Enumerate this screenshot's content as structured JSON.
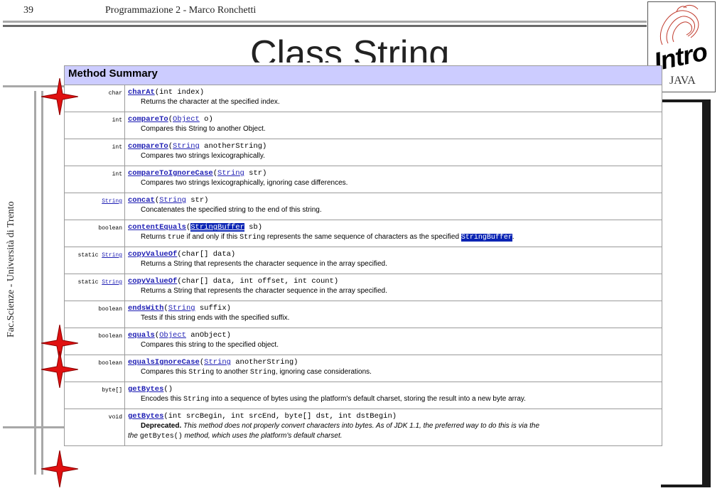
{
  "slide": {
    "number": "39",
    "header": "Programmazione 2  -  Marco Ronchetti",
    "title": "Class String",
    "side_text": "Fac.Scienze - Università di Trento"
  },
  "logo": {
    "word": "Intro",
    "sub": "JAVA"
  },
  "summary": {
    "header": "Method Summary",
    "rows": [
      {
        "mod": "char",
        "name": "charAt",
        "sig_after": "(int index)",
        "desc": "Returns the character at the specified index."
      },
      {
        "mod": "int",
        "name": "compareTo",
        "p_link": "Object",
        "sig_after": " o)",
        "desc": "Compares this String to another Object."
      },
      {
        "mod": "int",
        "name": "compareTo",
        "p_link": "String",
        "sig_after": " anotherString)",
        "desc": "Compares two strings lexicographically."
      },
      {
        "mod": "int",
        "name": "compareToIgnoreCase",
        "p_link": "String",
        "sig_after": " str)",
        "desc": "Compares two strings lexicographically, ignoring case differences."
      },
      {
        "mod_link": "String",
        "name": "concat",
        "p_link": "String",
        "sig_after": " str)",
        "desc": "Concatenates the specified string to the end of this string."
      },
      {
        "mod": "boolean",
        "name": "contentEquals",
        "p_hl": "StringBuffer",
        "sig_after": " sb)",
        "desc_a": "Returns ",
        "desc_code1": "true",
        "desc_b": " if and only if this ",
        "desc_code2": "String",
        "desc_c": " represents the same sequence of characters as the specified ",
        "desc_hl": "StringBuffer",
        "desc_d": "."
      },
      {
        "mod_pre": "static ",
        "mod_link": "String",
        "name": "copyValueOf",
        "sig_after": "(char[] data)",
        "desc": "Returns a String that represents the character sequence in the array specified."
      },
      {
        "mod_pre": "static ",
        "mod_link": "String",
        "name": "copyValueOf",
        "sig_after": "(char[] data, int offset, int count)",
        "desc": "Returns a String that represents the character sequence in the array specified."
      },
      {
        "mod": "boolean",
        "name": "endsWith",
        "p_link": "String",
        "sig_after": " suffix)",
        "desc": "Tests if this string ends with the specified suffix."
      },
      {
        "mod": "boolean",
        "name": "equals",
        "p_link": "Object",
        "sig_after": " anObject)",
        "desc": "Compares this string to the specified object."
      },
      {
        "mod": "boolean",
        "name": "equalsIgnoreCase",
        "p_link": "String",
        "sig_after": " anotherString)",
        "desc_a": "Compares this ",
        "desc_code1": "String",
        "desc_b": " to another ",
        "desc_code2": "String",
        "desc_c": ", ignoring case considerations."
      },
      {
        "mod": "byte[]",
        "name": "getBytes",
        "sig_after": "()",
        "desc_a": "Encodes this ",
        "desc_code1": "String",
        "desc_b": " into a sequence of bytes using the platform's default charset, storing the result into a new byte array."
      },
      {
        "mod": "void",
        "name": "getBytes",
        "sig_after": "(int srcBegin, int srcEnd, byte[] dst, int dstBegin)",
        "dep_word": "Deprecated.",
        "dep_a": " This method does not properly convert characters into bytes. As of JDK 1.1, the preferred way to do this is via the",
        "dep_b": "the ",
        "dep_code": "getBytes()",
        "dep_c": " method, which uses the platform's default charset."
      }
    ]
  },
  "colors": {
    "header_bg": "#ccccff",
    "link": "#1e1eb4",
    "highlight": "#0a24b4",
    "star": "#e01010"
  }
}
